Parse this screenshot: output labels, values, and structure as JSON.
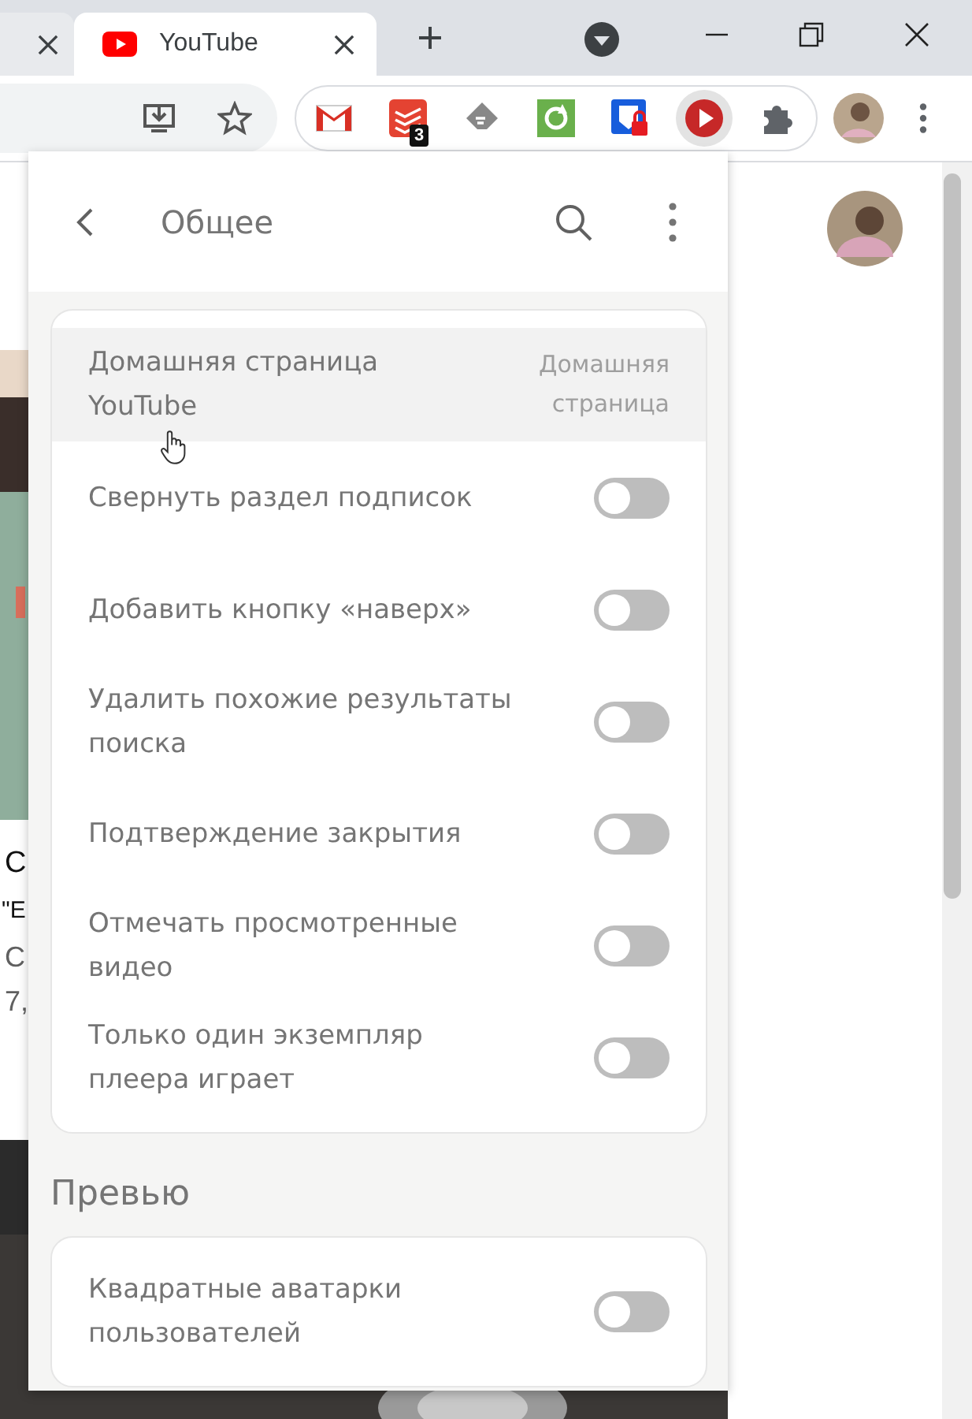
{
  "tabs": [
    {
      "selected": false
    },
    {
      "label": "YouTube",
      "selected": true
    }
  ],
  "extensions": [
    {
      "kind": "mail",
      "active": false
    },
    {
      "kind": "tasks",
      "badge": "3",
      "active": false
    },
    {
      "kind": "feed",
      "active": false
    },
    {
      "kind": "refresh",
      "active": false
    },
    {
      "kind": "lock",
      "active": false
    },
    {
      "kind": "play",
      "active": true
    },
    {
      "kind": "puzzle",
      "active": false
    }
  ],
  "page_fragments": [
    "С",
    "\"Е",
    "С",
    "7,"
  ],
  "popup": {
    "title": "Общее",
    "sections": [
      {
        "rows": [
          {
            "kind": "value",
            "label": "Домашняя страница YouTube",
            "value": "Домашняя страница",
            "highlighted": true
          },
          {
            "kind": "toggle",
            "label": "Свернуть раздел подписок",
            "on": false,
            "highlighted": false
          },
          {
            "kind": "toggle",
            "label": "Добавить кнопку «наверх»",
            "on": false,
            "highlighted": false
          },
          {
            "kind": "toggle",
            "label": "Удалить похожие результаты поиска",
            "on": false,
            "highlighted": false
          },
          {
            "kind": "toggle",
            "label": "Подтверждение закрытия",
            "on": false,
            "highlighted": false
          },
          {
            "kind": "toggle",
            "label": "Отмечать просмотренные видео",
            "on": false,
            "highlighted": false
          },
          {
            "kind": "toggle",
            "label": "Только один экземпляр плеера играет",
            "on": false,
            "highlighted": false
          }
        ]
      },
      {
        "title": "Превью",
        "rows": [
          {
            "kind": "toggle",
            "label": "Квадратные аватарки пользователей",
            "on": false,
            "highlighted": false
          }
        ]
      }
    ]
  }
}
